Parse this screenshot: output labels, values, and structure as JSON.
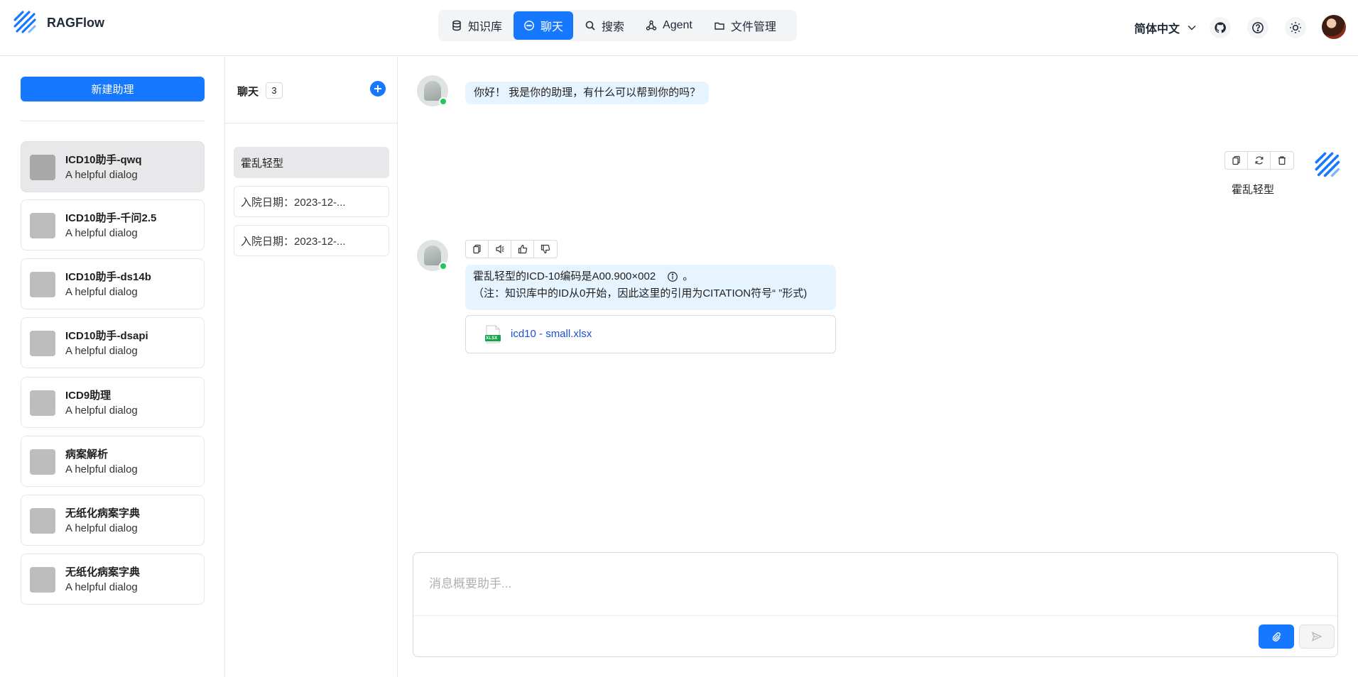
{
  "app": {
    "brand": "RAGFlow"
  },
  "nav": {
    "items": [
      {
        "label": "知识库",
        "icon": "database-icon"
      },
      {
        "label": "聊天",
        "icon": "chat-bubble-icon",
        "active": true
      },
      {
        "label": "搜索",
        "icon": "search-icon"
      },
      {
        "label": "Agent",
        "icon": "agent-graph-icon"
      },
      {
        "label": "文件管理",
        "icon": "folder-icon"
      }
    ]
  },
  "header": {
    "language": "简体中文"
  },
  "left": {
    "new_button": "新建助理",
    "assistants": [
      {
        "name": "ICD10助手-qwq",
        "desc": "A helpful dialog",
        "active": true
      },
      {
        "name": "ICD10助手-千问2.5",
        "desc": "A helpful dialog"
      },
      {
        "name": "ICD10助手-ds14b",
        "desc": "A helpful dialog"
      },
      {
        "name": "ICD10助手-dsapi",
        "desc": "A helpful dialog"
      },
      {
        "name": "ICD9助理",
        "desc": "A helpful dialog"
      },
      {
        "name": "病案解析",
        "desc": "A helpful dialog"
      },
      {
        "name": "无纸化病案字典",
        "desc": "A helpful dialog"
      },
      {
        "name": "无纸化病案字典",
        "desc": "A helpful dialog"
      }
    ]
  },
  "middle": {
    "title": "聊天",
    "count": "3",
    "conversations": [
      {
        "label": "霍乱轻型",
        "active": true
      },
      {
        "label": "入院日期：2023-12-..."
      },
      {
        "label": "入院日期：2023-12-..."
      }
    ]
  },
  "chat": {
    "greeting": "你好！ 我是你的助理，有什么可以帮到你的吗？",
    "user_message": "霍乱轻型",
    "answer_line1": "霍乱轻型的ICD-10编码是A00.900×002",
    "answer_line1_suffix": "。",
    "answer_line2": "（注：知识库中的ID从0开始，因此这里的引用为CITATION符号“ ”形式)",
    "file_name": "icd10 - small.xlsx",
    "file_type": "XLSX",
    "input_placeholder": "消息概要助手..."
  },
  "colors": {
    "accent": "#1677ff",
    "bubble": "#e6f4ff",
    "online": "#22c55e"
  }
}
